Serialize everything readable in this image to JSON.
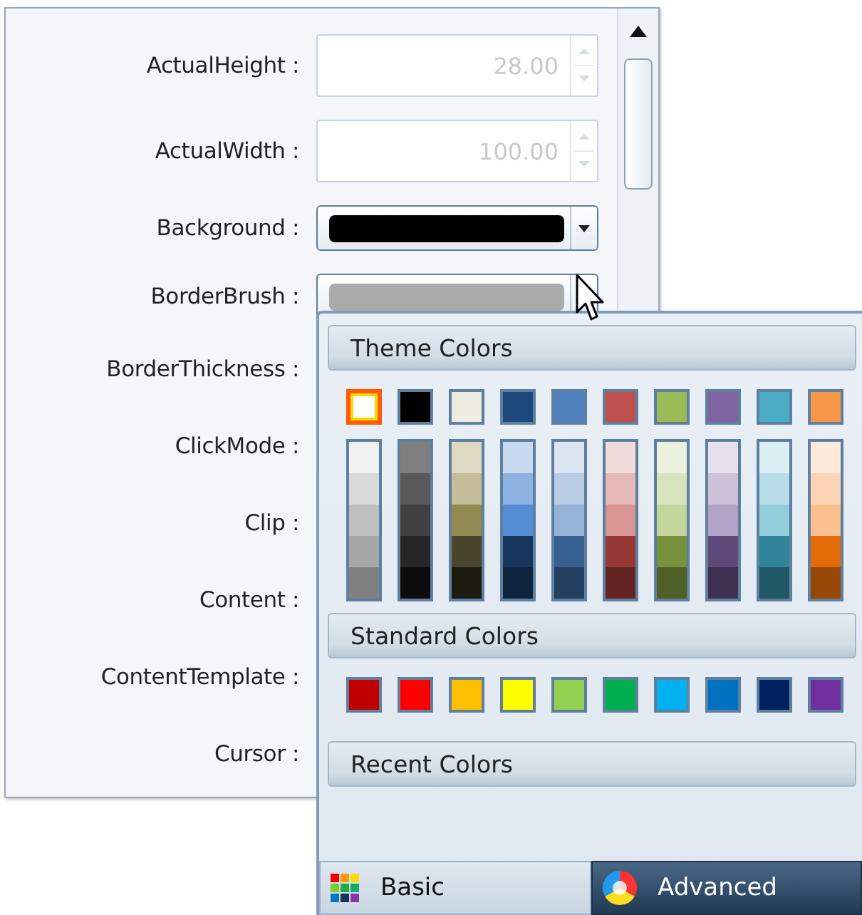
{
  "properties": [
    {
      "label": "ActualHeight :",
      "kind": "number",
      "value": "28.00",
      "disabled": true
    },
    {
      "label": "ActualWidth :",
      "kind": "number",
      "value": "100.00",
      "disabled": true
    },
    {
      "label": "Background :",
      "kind": "color",
      "color": "#000000"
    },
    {
      "label": "BorderBrush :",
      "kind": "color",
      "color": "#aaaaaa"
    },
    {
      "label": "BorderThickness :"
    },
    {
      "label": "ClickMode :"
    },
    {
      "label": "Clip :"
    },
    {
      "label": "Content :"
    },
    {
      "label": "ContentTemplate :"
    },
    {
      "label": "Cursor :"
    }
  ],
  "color_picker": {
    "theme_header": "Theme Colors",
    "theme_colors": [
      {
        "color": "#ffffff",
        "selected": true,
        "shades": [
          {
            "color": "#f2f2f2"
          },
          {
            "color": "#d9d9d9"
          },
          {
            "color": "#bfbfbf"
          },
          {
            "color": "#a6a6a6"
          },
          {
            "color": "#808080"
          }
        ]
      },
      {
        "color": "#000000",
        "selected": false,
        "shades": [
          {
            "color": "#7f7f7f"
          },
          {
            "color": "#595959"
          },
          {
            "color": "#404040"
          },
          {
            "color": "#262626"
          },
          {
            "color": "#0d0d0d"
          }
        ]
      },
      {
        "color": "#eeece1",
        "selected": false,
        "shades": [
          {
            "color": "#ddd9c3"
          },
          {
            "color": "#c4bd97"
          },
          {
            "color": "#938953"
          },
          {
            "color": "#4a452a"
          },
          {
            "color": "#1d1b10"
          }
        ]
      },
      {
        "color": "#1f497d",
        "selected": false,
        "shades": [
          {
            "color": "#c6d9f0"
          },
          {
            "color": "#8db3e2"
          },
          {
            "color": "#548dd4"
          },
          {
            "color": "#17365d"
          },
          {
            "color": "#0f243e"
          }
        ]
      },
      {
        "color": "#4f81bd",
        "selected": false,
        "shades": [
          {
            "color": "#dbe5f1"
          },
          {
            "color": "#b8cce4"
          },
          {
            "color": "#95b3d7"
          },
          {
            "color": "#366092"
          },
          {
            "color": "#244061"
          }
        ]
      },
      {
        "color": "#c0504d",
        "selected": false,
        "shades": [
          {
            "color": "#f2dcdb"
          },
          {
            "color": "#e5b9b7"
          },
          {
            "color": "#d99694"
          },
          {
            "color": "#953734"
          },
          {
            "color": "#632423"
          }
        ]
      },
      {
        "color": "#9bbb59",
        "selected": false,
        "shades": [
          {
            "color": "#ebf1dd"
          },
          {
            "color": "#d7e3bc"
          },
          {
            "color": "#c3d69b"
          },
          {
            "color": "#76923c"
          },
          {
            "color": "#4f6128"
          }
        ]
      },
      {
        "color": "#8064a2",
        "selected": false,
        "shades": [
          {
            "color": "#e5e0ec"
          },
          {
            "color": "#ccc1d9"
          },
          {
            "color": "#b2a2c7"
          },
          {
            "color": "#5f497a"
          },
          {
            "color": "#3f3151"
          }
        ]
      },
      {
        "color": "#4bacc6",
        "selected": false,
        "shades": [
          {
            "color": "#dbeef3"
          },
          {
            "color": "#b7dde8"
          },
          {
            "color": "#92cddc"
          },
          {
            "color": "#31859b"
          },
          {
            "color": "#205867"
          }
        ]
      },
      {
        "color": "#f79646",
        "selected": false,
        "shades": [
          {
            "color": "#fdeada"
          },
          {
            "color": "#fbd5b5"
          },
          {
            "color": "#fac08f"
          },
          {
            "color": "#e36c09"
          },
          {
            "color": "#974806"
          }
        ]
      }
    ],
    "standard_header": "Standard Colors",
    "standard_colors": [
      {
        "color": "#c00000"
      },
      {
        "color": "#ff0000"
      },
      {
        "color": "#ffc000"
      },
      {
        "color": "#ffff00"
      },
      {
        "color": "#92d050"
      },
      {
        "color": "#00b050"
      },
      {
        "color": "#00b0f0"
      },
      {
        "color": "#0070c0"
      },
      {
        "color": "#002060"
      },
      {
        "color": "#7030a0"
      }
    ],
    "recent_header": "Recent Colors",
    "tabs": [
      {
        "label": "Basic",
        "kind": "basic",
        "selected": true
      },
      {
        "label": "Advanced",
        "kind": "advanced",
        "selected": false
      }
    ]
  }
}
